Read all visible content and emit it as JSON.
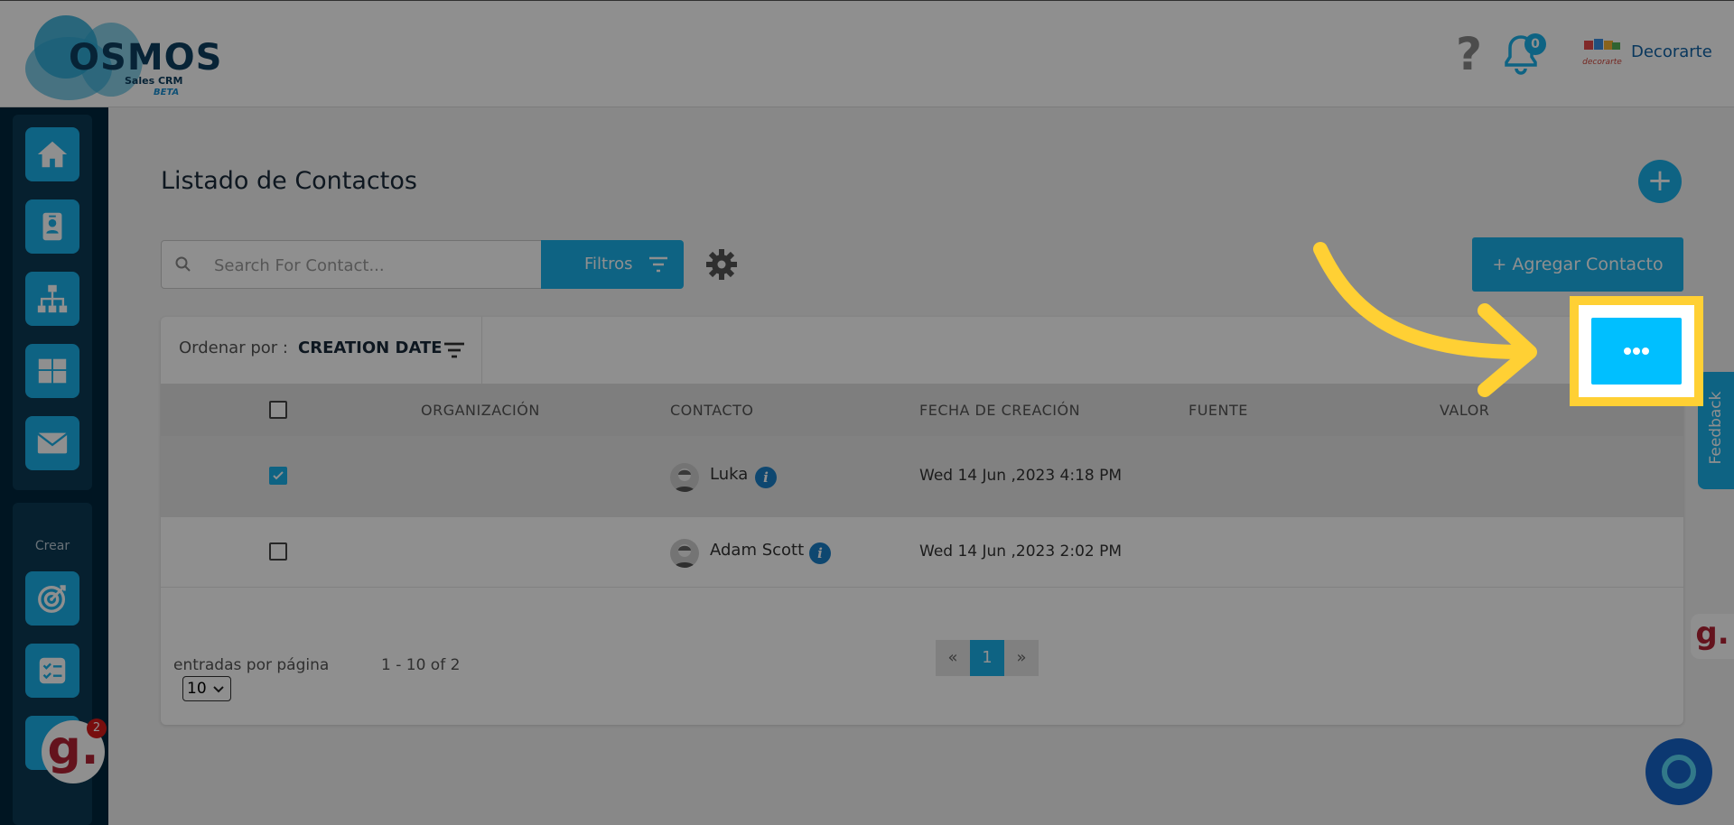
{
  "app": {
    "brand": "OSMOS",
    "brand_sub": "Sales CRM",
    "brand_tag": "BETA"
  },
  "header": {
    "help_glyph": "?",
    "notifications_count": "0",
    "company_name": "Decorarte",
    "company_logo_text": "decorarte"
  },
  "sidebar": {
    "items": [
      {
        "name": "home-icon"
      },
      {
        "name": "contact-card-icon"
      },
      {
        "name": "org-chart-icon"
      },
      {
        "name": "dashboard-grid-icon"
      },
      {
        "name": "mail-icon"
      }
    ],
    "create_label": "Crear",
    "create_items": [
      {
        "name": "target-icon"
      },
      {
        "name": "checklist-icon"
      }
    ]
  },
  "main": {
    "title": "Listado de Contactos",
    "add_fab": "+",
    "search": {
      "placeholder": "Search For Contact...",
      "value": ""
    },
    "filter_label": "Filtros",
    "add_contact_label": "+ Agregar Contacto",
    "sort": {
      "label": "Ordenar por :",
      "value": "CREATION DATE"
    },
    "columns": [
      "ORGANIZACIÓN",
      "CONTACTO",
      "FECHA DE CREACIÓN",
      "FUENTE",
      "VALOR"
    ],
    "rows": [
      {
        "checked": true,
        "organization": "",
        "contact": "Luka",
        "created": "Wed 14 Jun ,2023 4:18 PM",
        "source": "",
        "value": ""
      },
      {
        "checked": false,
        "organization": "",
        "contact": "Adam Scott",
        "created": "Wed 14 Jun ,2023 2:02 PM",
        "source": "",
        "value": ""
      }
    ],
    "info_glyph": "i",
    "footer": {
      "entries_label": "entradas por página",
      "range": "1 - 10 of 2",
      "per_page": "10"
    },
    "pager": {
      "prev": "«",
      "current": "1",
      "next": "»"
    }
  },
  "overlay": {
    "more_button": "more-options"
  },
  "widgets": {
    "feedback_label": "Feedback",
    "g_logo": "g.",
    "g_badge": "2"
  },
  "colors": {
    "accent": "#1ab1ea",
    "sidebar": "#00263d",
    "highlight": "#ffd034"
  }
}
